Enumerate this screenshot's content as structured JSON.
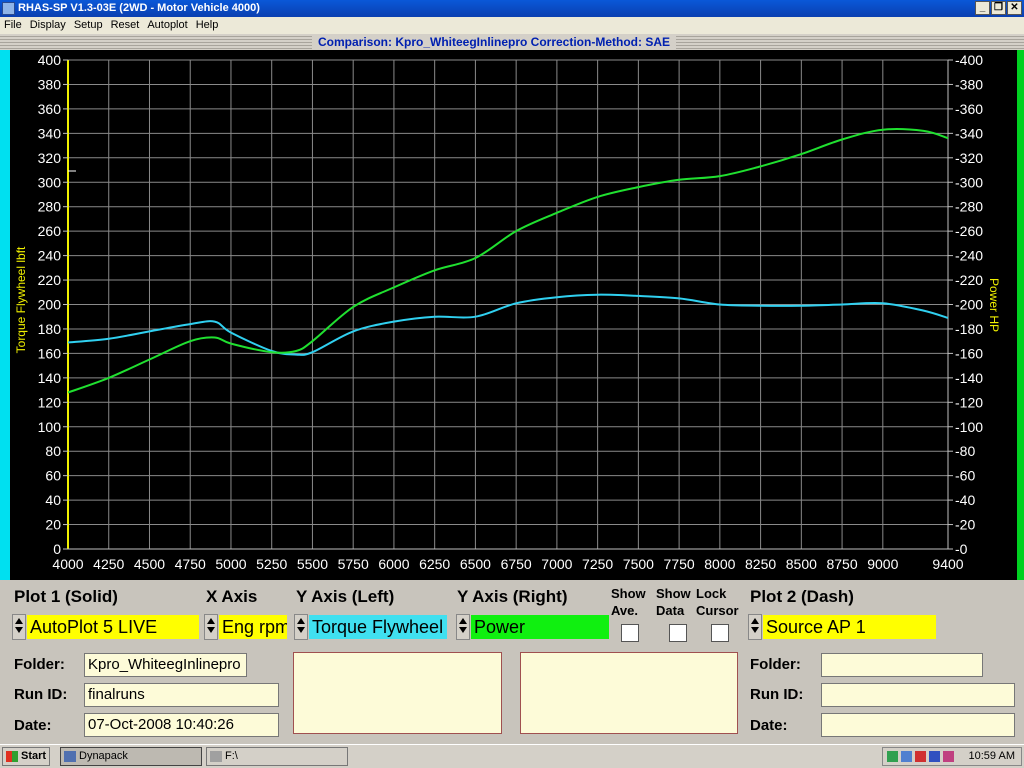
{
  "window": {
    "title": "RHAS-SP V1.3-03E  (2WD - Motor Vehicle 4000)",
    "buttons": {
      "minimize": "_",
      "restore": "❐",
      "close": "✕"
    }
  },
  "menu": [
    "File",
    "Display",
    "Setup",
    "Reset",
    "Autoplot",
    "Help"
  ],
  "comparison_bar": "Comparison: Kpro_WhiteegInlinepro    Correction-Method: SAE",
  "chart_data": {
    "type": "line",
    "x": [
      4000,
      4250,
      4500,
      4750,
      4900,
      5000,
      5250,
      5400,
      5500,
      5750,
      6000,
      6250,
      6500,
      6750,
      7000,
      7250,
      7500,
      7750,
      8000,
      8250,
      8500,
      8750,
      9000,
      9250,
      9400
    ],
    "series": [
      {
        "name": "Torque Flywheel lbft",
        "axis": "left",
        "color": "#30d0f0",
        "values": [
          169,
          172,
          178,
          184,
          186,
          177,
          162,
          159,
          161,
          178,
          186,
          190,
          190,
          201,
          206,
          208,
          207,
          205,
          200,
          199,
          199,
          200,
          201,
          195,
          189
        ]
      },
      {
        "name": "Power HP",
        "axis": "right",
        "color": "#20e030",
        "values": [
          128,
          140,
          155,
          170,
          173,
          168,
          161,
          162,
          170,
          198,
          214,
          228,
          238,
          260,
          275,
          288,
          296,
          302,
          305,
          313,
          323,
          335,
          343,
          342,
          336
        ]
      }
    ],
    "xticks": [
      "4000",
      "4250",
      "4500",
      "4750",
      "5000",
      "5250",
      "5500",
      "5750",
      "6000",
      "6250",
      "6500",
      "6750",
      "7000",
      "7250",
      "7500",
      "7750",
      "8000",
      "8250",
      "8500",
      "8750",
      "9000",
      "9400"
    ],
    "yticks": [
      "0",
      "20",
      "40",
      "60",
      "80",
      "100",
      "120",
      "140",
      "160",
      "180",
      "200",
      "220",
      "240",
      "260",
      "280",
      "300",
      "320",
      "340",
      "360",
      "380",
      "400"
    ],
    "ylabel_left": "Torque Flywheel lbft",
    "ylabel_right": "Power HP",
    "xlim": [
      4000,
      9400
    ],
    "ylim": [
      0,
      400
    ],
    "grid": true
  },
  "panel": {
    "plot1": {
      "label": "Plot 1 (Solid)",
      "value": "AutoPlot 5 LIVE"
    },
    "xaxis": {
      "label": "X Axis",
      "value": "Eng rpm"
    },
    "yleft": {
      "label": "Y Axis (Left)",
      "value": "Torque Flywheel"
    },
    "yright": {
      "label": "Y Axis (Right)",
      "value": "Power"
    },
    "show_ave": {
      "line1": "Show",
      "line2": "Ave."
    },
    "show_data": {
      "line1": "Show",
      "line2": "Data"
    },
    "lock_cursor": {
      "line1": "Lock",
      "line2": "Cursor"
    },
    "plot2": {
      "label": "Plot 2 (Dash)",
      "value": "Source AP 1"
    },
    "folder_label": "Folder:",
    "runid_label": "Run ID:",
    "date_label": "Date:",
    "left": {
      "folder": "Kpro_WhiteegInlinepro",
      "runid": "finalruns",
      "date": "07-Oct-2008  10:40:26"
    },
    "right": {
      "folder": "",
      "runid": "",
      "date": ""
    }
  },
  "taskbar": {
    "start": "Start",
    "items": [
      "Dynapack",
      "F:\\"
    ],
    "clock": "10:59 AM"
  },
  "colors": {
    "torque": "#30d0f0",
    "power": "#20e030",
    "yellow": "#ffff00",
    "cyan": "#40e0f0",
    "green": "#10f010"
  }
}
